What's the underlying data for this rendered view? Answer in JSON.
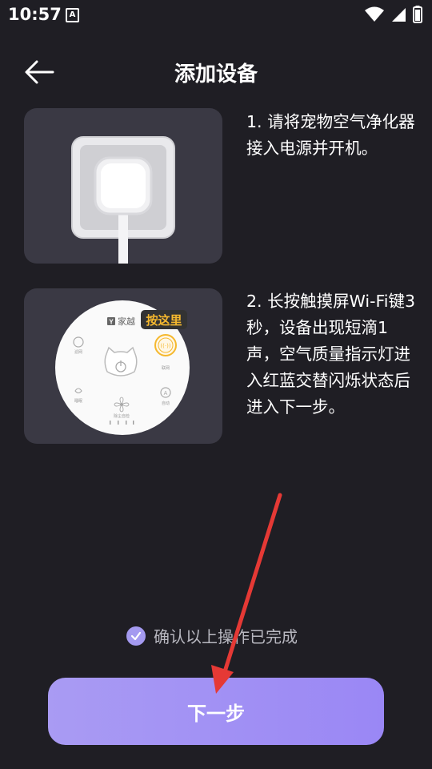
{
  "status_bar": {
    "time": "10:57",
    "a_badge": "A"
  },
  "header": {
    "title": "添加设备",
    "back_icon": "arrow-left-icon"
  },
  "steps": [
    {
      "text": "1. 请将宠物空气净化器接入电源并开机。"
    },
    {
      "text": "2. 长按触摸屏Wi-Fi键3秒，设备出现短滴1声，空气质量指示灯进入红蓝交替闪烁状态后进入下一步。"
    }
  ],
  "device_panel": {
    "brand": "家越",
    "tooltip": "按这里",
    "labels": {
      "left_top": "滤网",
      "right_mid": "联网",
      "left_bottom": "睡眠",
      "right_bottom": "自动",
      "bottom": "除尘自检"
    }
  },
  "confirm": {
    "label": "确认以上操作已完成",
    "checked": true
  },
  "next_button": {
    "label": "下一步"
  },
  "colors": {
    "background": "#1f1e24",
    "card": "#3a3944",
    "accent": "#a99bf3",
    "highlight": "#f5b82e",
    "annotation_arrow": "#e53935"
  }
}
